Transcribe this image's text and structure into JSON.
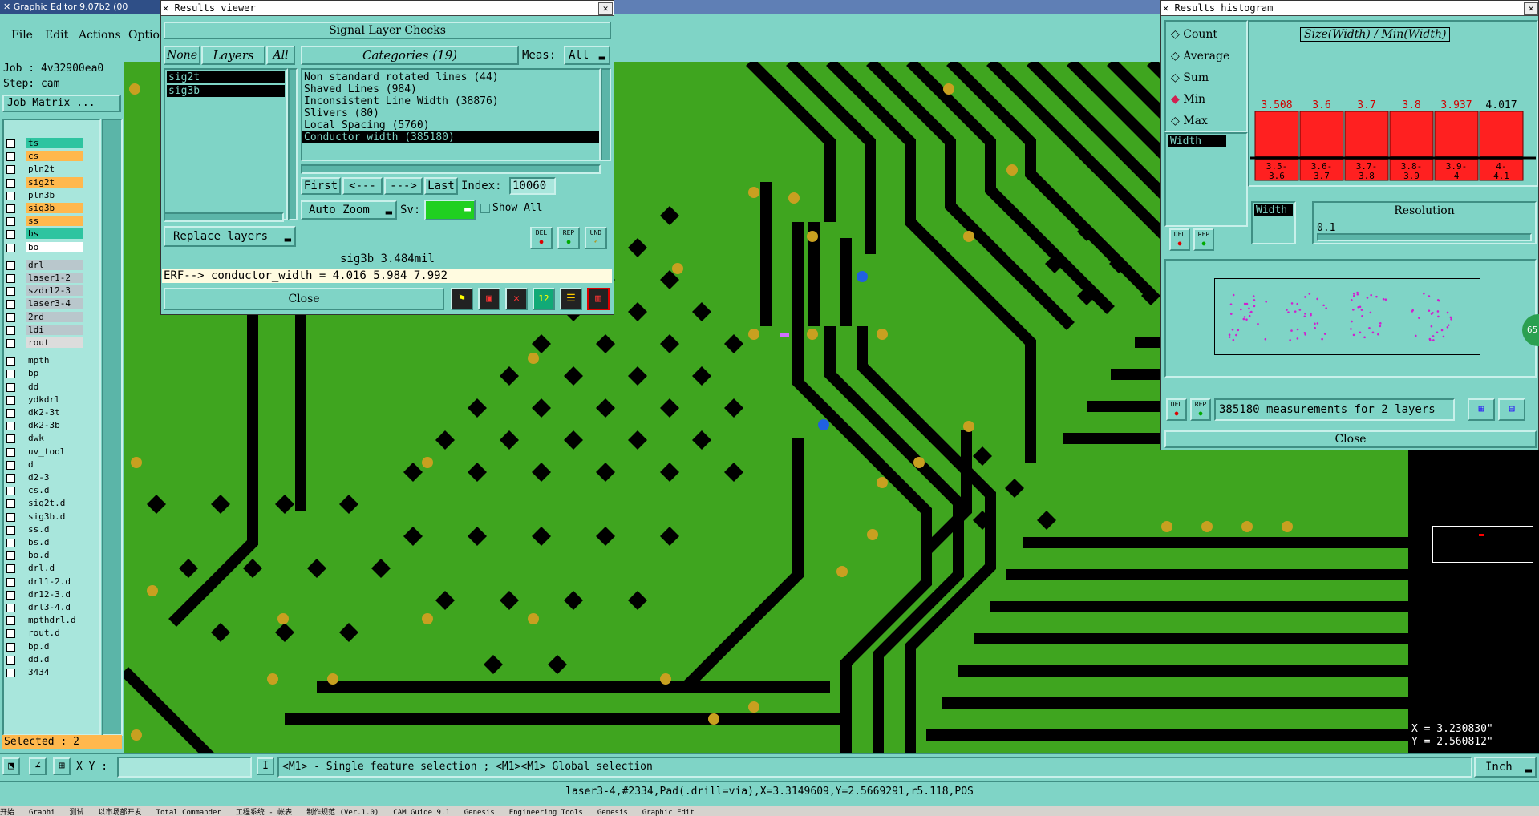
{
  "app": {
    "title": "Graphic Editor 9.07b2 (00"
  },
  "menu": {
    "file": "File",
    "edit": "Edit",
    "actions": "Actions",
    "options": "Optio"
  },
  "job": {
    "job_label": "Job : 4v32900ea0",
    "step_label": "Step: cam",
    "matrix_btn": "Job Matrix ..."
  },
  "layers": [
    {
      "name": "ts",
      "color": "#2ec4a0"
    },
    {
      "name": "cs",
      "color": "#ffb84d"
    },
    {
      "name": "pln2t",
      "color": "#a8e6dc"
    },
    {
      "name": "sig2t",
      "color": "#ffb84d"
    },
    {
      "name": "pln3b",
      "color": "#a8e6dc"
    },
    {
      "name": "sig3b",
      "color": "#ffb84d"
    },
    {
      "name": "ss",
      "color": "#ffb84d"
    },
    {
      "name": "bs",
      "color": "#2ec4a0"
    },
    {
      "name": "bo",
      "color": "#ffffff"
    },
    {
      "name": "drl",
      "color": "#b9c7cc"
    },
    {
      "name": "laser1-2",
      "color": "#b9c7cc"
    },
    {
      "name": "szdrl2-3",
      "color": "#b9c7cc"
    },
    {
      "name": "laser3-4",
      "color": "#b9c7cc"
    },
    {
      "name": "2rd",
      "color": "#b9c7cc"
    },
    {
      "name": "ldi",
      "color": "#b9c7cc"
    },
    {
      "name": "rout",
      "color": "#dcdcdc"
    },
    {
      "name": "mpth",
      "color": "#a8e6dc"
    },
    {
      "name": "bp",
      "color": "#a8e6dc"
    },
    {
      "name": "dd",
      "color": "#a8e6dc"
    },
    {
      "name": "ydkdrl",
      "color": "#a8e6dc"
    },
    {
      "name": "dk2-3t",
      "color": "#a8e6dc"
    },
    {
      "name": "dk2-3b",
      "color": "#a8e6dc"
    },
    {
      "name": "dwk",
      "color": "#a8e6dc"
    },
    {
      "name": "uv_tool",
      "color": "#a8e6dc"
    },
    {
      "name": "d",
      "color": "#a8e6dc"
    },
    {
      "name": "d2-3",
      "color": "#a8e6dc"
    },
    {
      "name": "cs.d",
      "color": "#a8e6dc"
    },
    {
      "name": "sig2t.d",
      "color": "#a8e6dc"
    },
    {
      "name": "sig3b.d",
      "color": "#a8e6dc"
    },
    {
      "name": "ss.d",
      "color": "#a8e6dc"
    },
    {
      "name": "bs.d",
      "color": "#a8e6dc"
    },
    {
      "name": "bo.d",
      "color": "#a8e6dc"
    },
    {
      "name": "drl.d",
      "color": "#a8e6dc"
    },
    {
      "name": "drl1-2.d",
      "color": "#a8e6dc"
    },
    {
      "name": "dr12-3.d",
      "color": "#a8e6dc"
    },
    {
      "name": "drl3-4.d",
      "color": "#a8e6dc"
    },
    {
      "name": "mpthdrl.d",
      "color": "#a8e6dc"
    },
    {
      "name": "rout.d",
      "color": "#a8e6dc"
    },
    {
      "name": "bp.d",
      "color": "#a8e6dc"
    },
    {
      "name": "dd.d",
      "color": "#a8e6dc"
    },
    {
      "name": "3434",
      "color": "#a8e6dc"
    }
  ],
  "selected": "Selected : 2",
  "results_viewer": {
    "title": "Results viewer",
    "header": "Signal Layer Checks",
    "none_btn": "None",
    "layers_btn": "Layers",
    "all_btn": "All",
    "categories_label": "Categories (19)",
    "meas_label": "Meas:",
    "meas_value": "All",
    "layer_list": [
      "sig2t",
      "sig3b"
    ],
    "categories": [
      "Non standard rotated lines (44)",
      "Shaved Lines (984)",
      "Inconsistent Line Width (38876)",
      "Slivers (80)",
      "Local Spacing (5760)",
      "Conductor width (385180)"
    ],
    "first": "First",
    "prev": "<---",
    "next": "--->",
    "last": "Last",
    "index_label": "Index:",
    "index_value": "10060",
    "auto_zoom": "Auto Zoom",
    "sv_label": "Sv:",
    "show_all": "Show All",
    "replace_layers": "Replace layers",
    "del": "DEL",
    "rep": "REP",
    "und": "UND",
    "status": "sig3b 3.484mil",
    "erf": "ERF--> conductor_width = 4.016 5.984 7.992",
    "close": "Close"
  },
  "histogram": {
    "title": "Results histogram",
    "opts": [
      "Count",
      "Average",
      "Sum",
      "Min",
      "Max"
    ],
    "selected_opt": "Min",
    "chart_title": "Size(Width) / Min(Width)",
    "list_item": "Width",
    "width_field": "Width",
    "resolution_label": "Resolution",
    "resolution_value": "0.1",
    "del": "DEL",
    "rep": "REP",
    "measurements": "385180 measurements for 2 layers",
    "close": "Close"
  },
  "chart_data": {
    "type": "bar",
    "title": "Size(Width) / Min(Width)",
    "categories": [
      "3.5-3.6",
      "3.6-3.7",
      "3.7-3.8",
      "3.8-3.9",
      "3.9-4",
      "4-4.1"
    ],
    "values": [
      3.508,
      3.6,
      3.7,
      3.8,
      3.937,
      4.017
    ],
    "value_labels": [
      "3.508",
      "3.6",
      "3.7",
      "3.8",
      "3.937",
      "4.017"
    ],
    "bar_color": "#ff2020"
  },
  "coords": {
    "x": "X = 3.230830\"",
    "y": "Y = 2.560812\""
  },
  "bottom": {
    "xy_label": "X Y :",
    "hint": "<M1> - Single feature selection ; <M1><M1> Global selection",
    "units": "Inch",
    "status_line": "laser3-4,#2334,Pad(.drill=via),X=3.3149609,Y=2.5669291,r5.118,POS"
  },
  "badge": "65",
  "taskbar": [
    "开始",
    "Graphi",
    "测试",
    "以市场部开发",
    "Total Commander",
    "工程系统 - 帐表",
    "制作规范 (Ver.1.0)",
    "CAM Guide 9.1",
    "Genesis",
    "Engineering Tools",
    "Genesis",
    "Graphic Edit"
  ]
}
